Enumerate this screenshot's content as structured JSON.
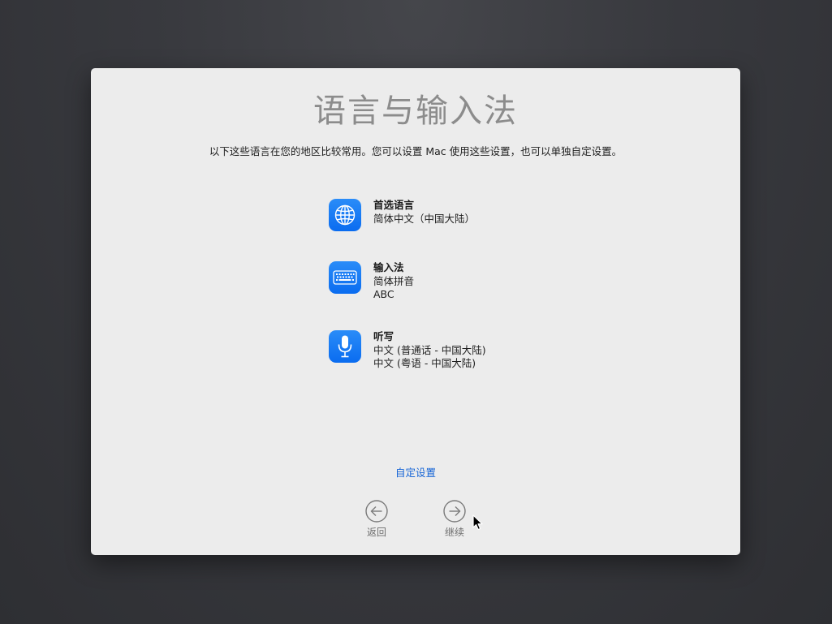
{
  "window": {
    "title": "语言与输入法",
    "subtitle": "以下这些语言在您的地区比较常用。您可以设置 Mac 使用这些设置，也可以单独自定设置。"
  },
  "items": [
    {
      "heading": "首选语言",
      "lines": [
        "简体中文（中国大陆）"
      ],
      "icon": "globe-icon"
    },
    {
      "heading": "输入法",
      "lines": [
        "简体拼音",
        "ABC"
      ],
      "icon": "keyboard-icon"
    },
    {
      "heading": "听写",
      "lines": [
        "中文 (普通话 - 中国大陆)",
        "中文 (粤语 - 中国大陆)"
      ],
      "icon": "microphone-icon"
    }
  ],
  "customize_link": "自定设置",
  "nav": {
    "back_label": "返回",
    "continue_label": "继续",
    "back_icon": "arrow-left-circle-icon",
    "continue_icon": "arrow-right-circle-icon"
  },
  "colors": {
    "accent": "#0a6cf0",
    "link": "#1665d6",
    "title": "#8c8c8c"
  }
}
